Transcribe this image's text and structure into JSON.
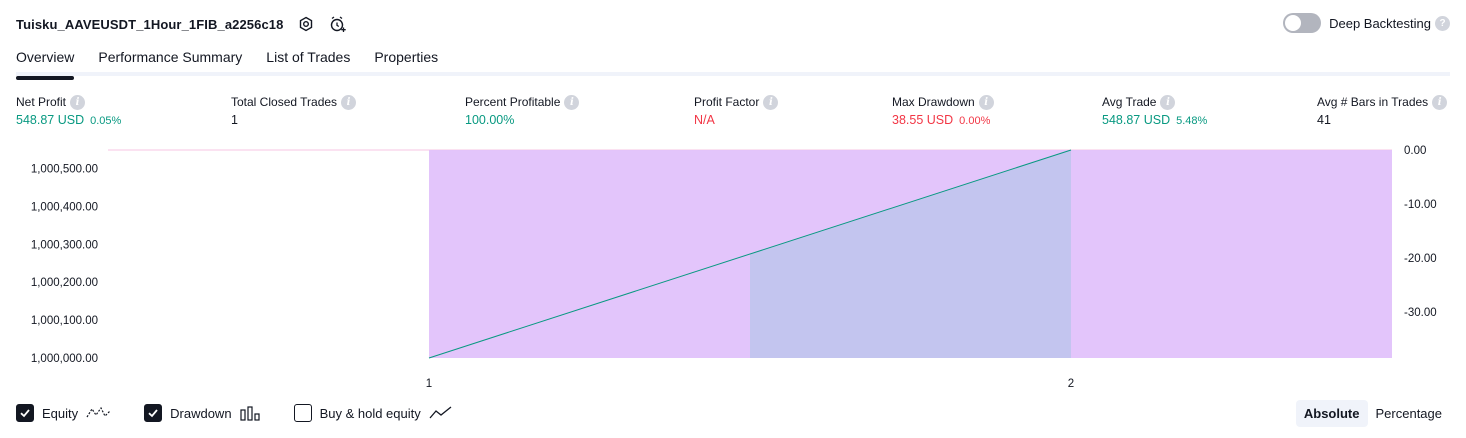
{
  "header": {
    "title": "Tuisku_AAVEUSDT_1Hour_1FIB_a2256c18",
    "deep_backtesting_label": "Deep Backtesting"
  },
  "tabs": [
    {
      "label": "Overview",
      "active": true
    },
    {
      "label": "Performance Summary"
    },
    {
      "label": "List of Trades"
    },
    {
      "label": "Properties"
    }
  ],
  "stats": {
    "net_profit": {
      "label": "Net Profit",
      "value": "548.87 USD",
      "pct": "0.05%"
    },
    "total_closed_trades": {
      "label": "Total Closed Trades",
      "value": "1"
    },
    "percent_profitable": {
      "label": "Percent Profitable",
      "value": "100.00%"
    },
    "profit_factor": {
      "label": "Profit Factor",
      "value": "N/A"
    },
    "max_drawdown": {
      "label": "Max Drawdown",
      "value": "38.55 USD",
      "pct": "0.00%"
    },
    "avg_trade": {
      "label": "Avg Trade",
      "value": "548.87 USD",
      "pct": "5.48%"
    },
    "avg_bars": {
      "label": "Avg # Bars in Trades",
      "value": "41"
    }
  },
  "chart_data": {
    "type": "area",
    "x_ticks": [
      "1",
      "2"
    ],
    "left_axis_ticks": [
      "1,000,500.00",
      "1,000,400.00",
      "1,000,300.00",
      "1,000,200.00",
      "1,000,100.00",
      "1,000,000.00"
    ],
    "right_axis_ticks": [
      "0.00",
      "-10.00",
      "-20.00",
      "-30.00"
    ],
    "ylim_left": [
      1000000,
      1000548.87
    ],
    "ylim_right": [
      -38.55,
      0
    ],
    "series": [
      {
        "name": "Equity",
        "x": [
          1,
          2
        ],
        "values": [
          1000000,
          1000548.87
        ],
        "color": "#089981"
      },
      {
        "name": "Drawdown",
        "x": [
          1.5,
          2.5
        ],
        "values": [
          -38.55,
          -38.55
        ],
        "color": "#c48cf4"
      }
    ]
  },
  "legend": {
    "equity": {
      "label": "Equity",
      "checked": true
    },
    "drawdown": {
      "label": "Drawdown",
      "checked": true
    },
    "buy_hold": {
      "label": "Buy & hold equity",
      "checked": false
    }
  },
  "modes": [
    {
      "label": "Absolute",
      "active": true
    },
    {
      "label": "Percentage",
      "active": false
    }
  ],
  "colors": {
    "positive": "#089981",
    "negative": "#f23645",
    "drawdown_fill": "#e1c2fb",
    "equity_fill": "#dff3ee"
  }
}
